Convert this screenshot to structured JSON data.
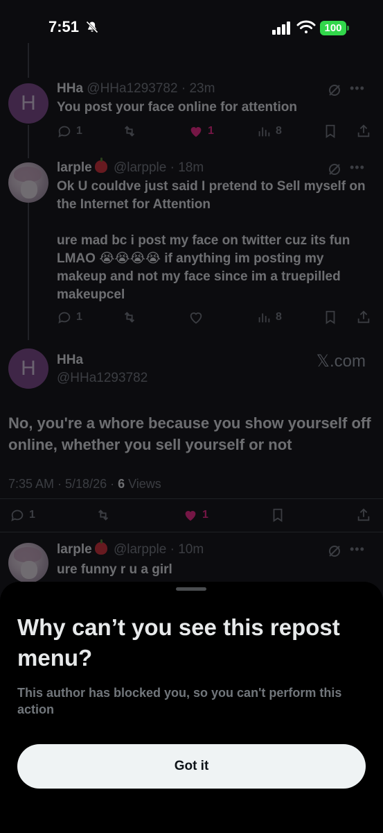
{
  "status_bar": {
    "time": "7:51",
    "battery": "100",
    "battery_color": "#32d74b",
    "icons": [
      "bell-slash-icon",
      "cellular-signal-icon",
      "wifi-icon",
      "battery-icon"
    ]
  },
  "timeline": {
    "replies": [
      {
        "name": "HHa",
        "handle": "@HHa1293782",
        "time": "· 23m",
        "avatar_letter": "H",
        "text": "You post your face online for attention",
        "replies": "1",
        "retweets": "",
        "likes": "1",
        "liked": true,
        "views": "8"
      },
      {
        "name": "larple",
        "handle": "@larpple",
        "time": "· 18m",
        "text_1": "Ok U couldve just said I pretend to Sell myself on the Internet for Attention",
        "text_2": "ure mad bc i post my face on twitter cuz its fun LMAO 😭😭😭😭 if anything im posting my makeup and not my face since im a truepilled makeupcel",
        "replies": "1",
        "retweets": "",
        "likes": "",
        "liked": false,
        "views": "8"
      }
    ],
    "focused_tweet": {
      "name": "HHa",
      "handle": "@HHa1293782",
      "avatar_letter": "H",
      "source": "𝕏.com",
      "text": "No, you're a whore because you show yourself off online, whether you sell yourself or not",
      "timestamp": "7:35 AM · 5/18/26 · ",
      "views_count": "6",
      "views_label": " Views",
      "replies": "1",
      "likes": "1"
    },
    "last_reply": {
      "name": "larple",
      "handle": "@larpple",
      "time": "· 10m",
      "text": "ure funny r u a girl"
    }
  },
  "sheet": {
    "title": "Why can’t you see this repost menu?",
    "body": "This author has blocked you, so you can't perform this action",
    "button_label": "Got it"
  },
  "colors": {
    "like": "#f91880",
    "muted": "#71767b",
    "text": "#e7e9ea",
    "button_bg": "#eff3f4"
  }
}
